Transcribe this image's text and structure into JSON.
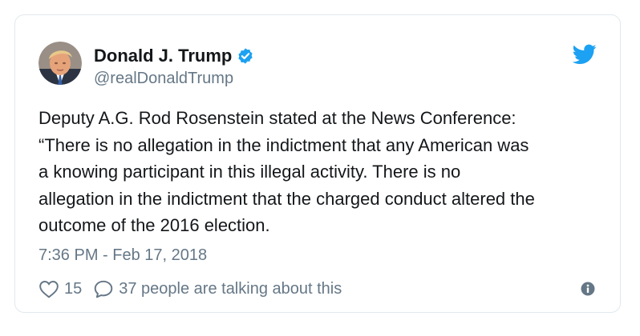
{
  "tweet": {
    "display_name": "Donald J. Trump",
    "handle": "@realDonaldTrump",
    "text_lines": [
      "Deputy A.G. Rod Rosenstein stated at the News Conference:",
      "“There is no allegation in the indictment that any American was",
      "a knowing participant in this illegal activity. There is no",
      "allegation in the indictment that the charged conduct altered the",
      "outcome of the 2016 election."
    ],
    "timestamp": "7:36 PM - Feb 17, 2018",
    "like_count": "15",
    "talking_text": "37 people are talking about this"
  },
  "icons": {
    "verified": "verified-badge-icon",
    "bird": "twitter-bird-icon",
    "heart": "heart-icon",
    "reply": "reply-bubble-icon",
    "info": "info-icon"
  },
  "colors": {
    "brand_blue": "#1da1f2",
    "text_primary": "#14171a",
    "text_secondary": "#657786",
    "border": "#e1e8ed"
  }
}
